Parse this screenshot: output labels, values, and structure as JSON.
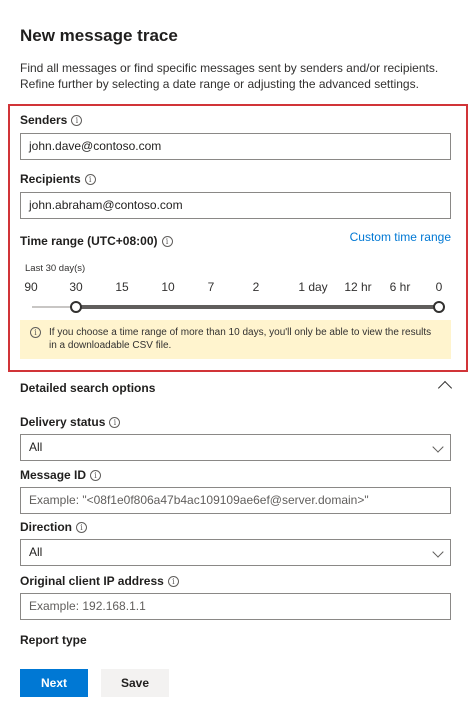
{
  "page": {
    "title": "New message trace",
    "description": "Find all messages or find specific messages sent by senders and/or recipients. Refine further by selecting a date range or adjusting the advanced settings."
  },
  "senders": {
    "label": "Senders",
    "value": "john.dave@contoso.com"
  },
  "recipients": {
    "label": "Recipients",
    "value": "john.abraham@contoso.com"
  },
  "time_range": {
    "label": "Time range (UTC+08:00)",
    "custom_link": "Custom time range",
    "selected_text": "Last 30 day(s)",
    "ticks": [
      "90",
      "30",
      "15",
      "10",
      "7",
      "2",
      "1 day",
      "12 hr",
      "6 hr",
      "0"
    ],
    "selected_start": "30",
    "selected_end": "0",
    "notice": "If you choose a time range of more than 10 days, you'll only be able to view the results in a downloadable CSV file."
  },
  "detailed": {
    "heading": "Detailed search options",
    "delivery_status": {
      "label": "Delivery status",
      "value": "All"
    },
    "message_id": {
      "label": "Message ID",
      "placeholder": "Example: \"<08f1e0f806a47b4ac109109ae6ef@server.domain>\""
    },
    "direction": {
      "label": "Direction",
      "value": "All"
    },
    "client_ip": {
      "label": "Original client IP address",
      "placeholder": "Example: 192.168.1.1"
    },
    "report_type": {
      "label": "Report type"
    }
  },
  "buttons": {
    "next": "Next",
    "save": "Save"
  },
  "colors": {
    "accent": "#0078d4",
    "highlight_border": "#d13438",
    "notice_bg": "#fff4ce"
  },
  "icons": {
    "info": "info-icon",
    "chevron_down": "chevron-down-icon",
    "chevron_up": "chevron-up-icon"
  }
}
